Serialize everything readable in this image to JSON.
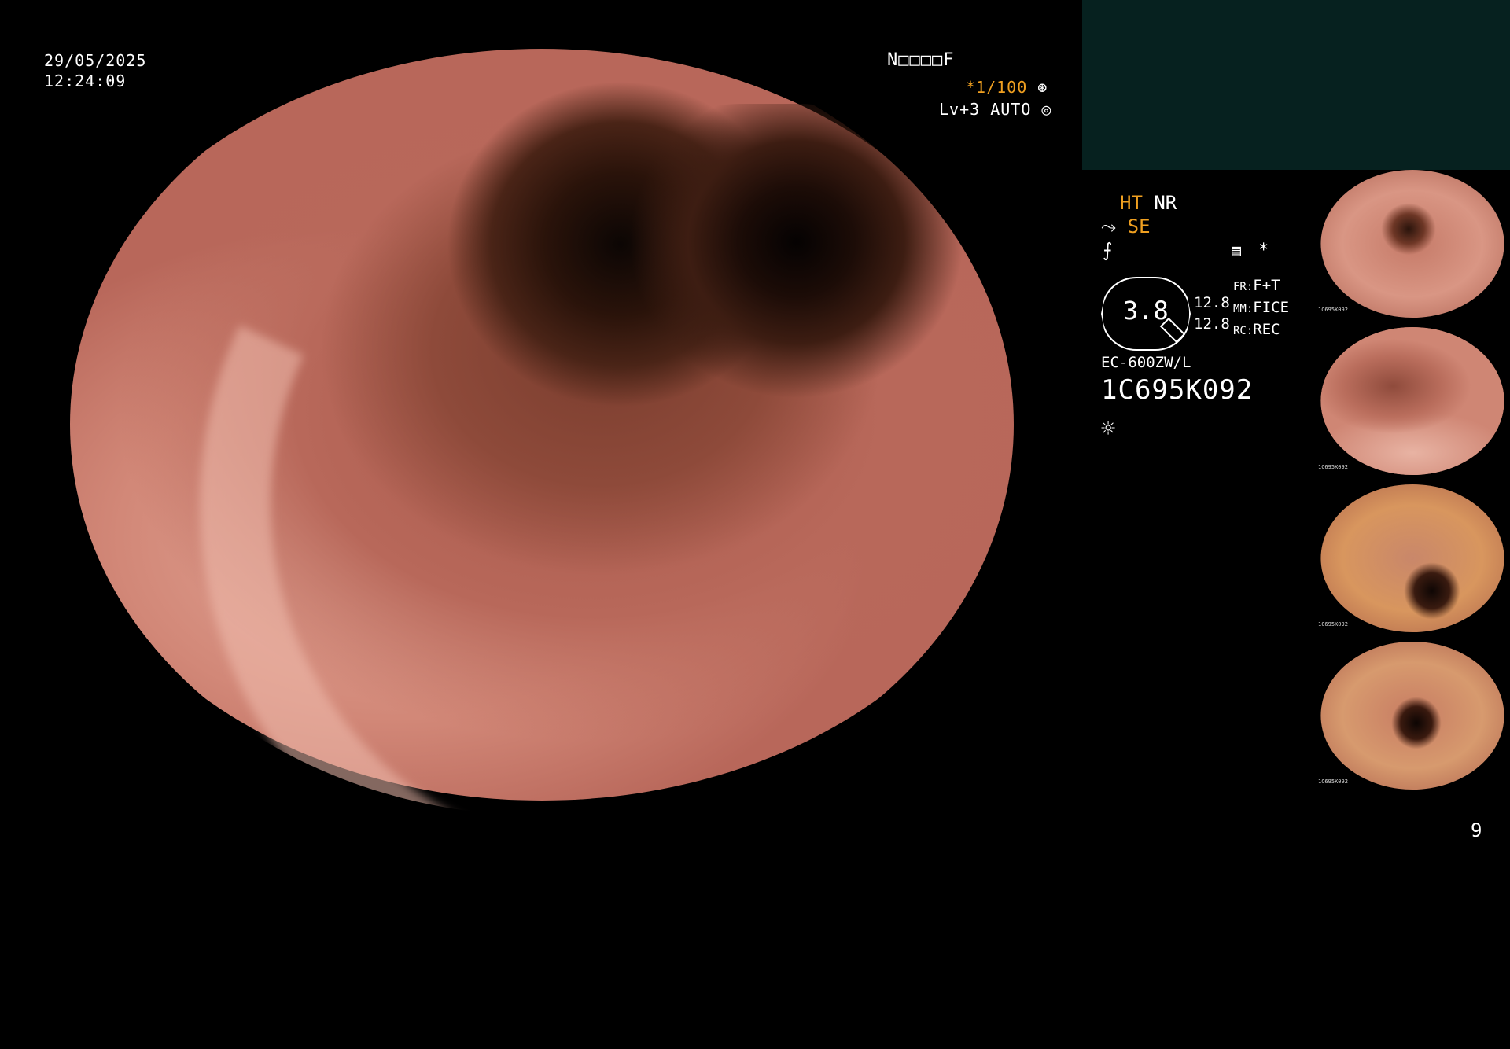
{
  "overlay": {
    "date": "29/05/2025",
    "time": "12:24:09",
    "mode_code": "N□□□□F",
    "shutter": "*1/100",
    "level": "Lv+3 AUTO"
  },
  "status_panel": {
    "ht": "HT",
    "nr": "NR",
    "se": "SE",
    "gauge_value": "3.8",
    "fr_value_left": "12.8",
    "mm_value_left": "12.8",
    "fr_label": "FR:",
    "fr_value": "F+T",
    "mm_label": "MM:",
    "mm_value": "FICE",
    "rc_label": "RC:",
    "rc_value": "REC",
    "scope_model": "EC-600ZW/L",
    "serial": "1C695K092"
  },
  "thumbnails": [
    {
      "label": "1C695K092"
    },
    {
      "label": "1C695K092"
    },
    {
      "label": "1C695K092"
    },
    {
      "label": "1C695K092"
    }
  ],
  "page_number": "9",
  "colors": {
    "accent_orange": "#f0a020",
    "top_panel": "#06211f"
  }
}
